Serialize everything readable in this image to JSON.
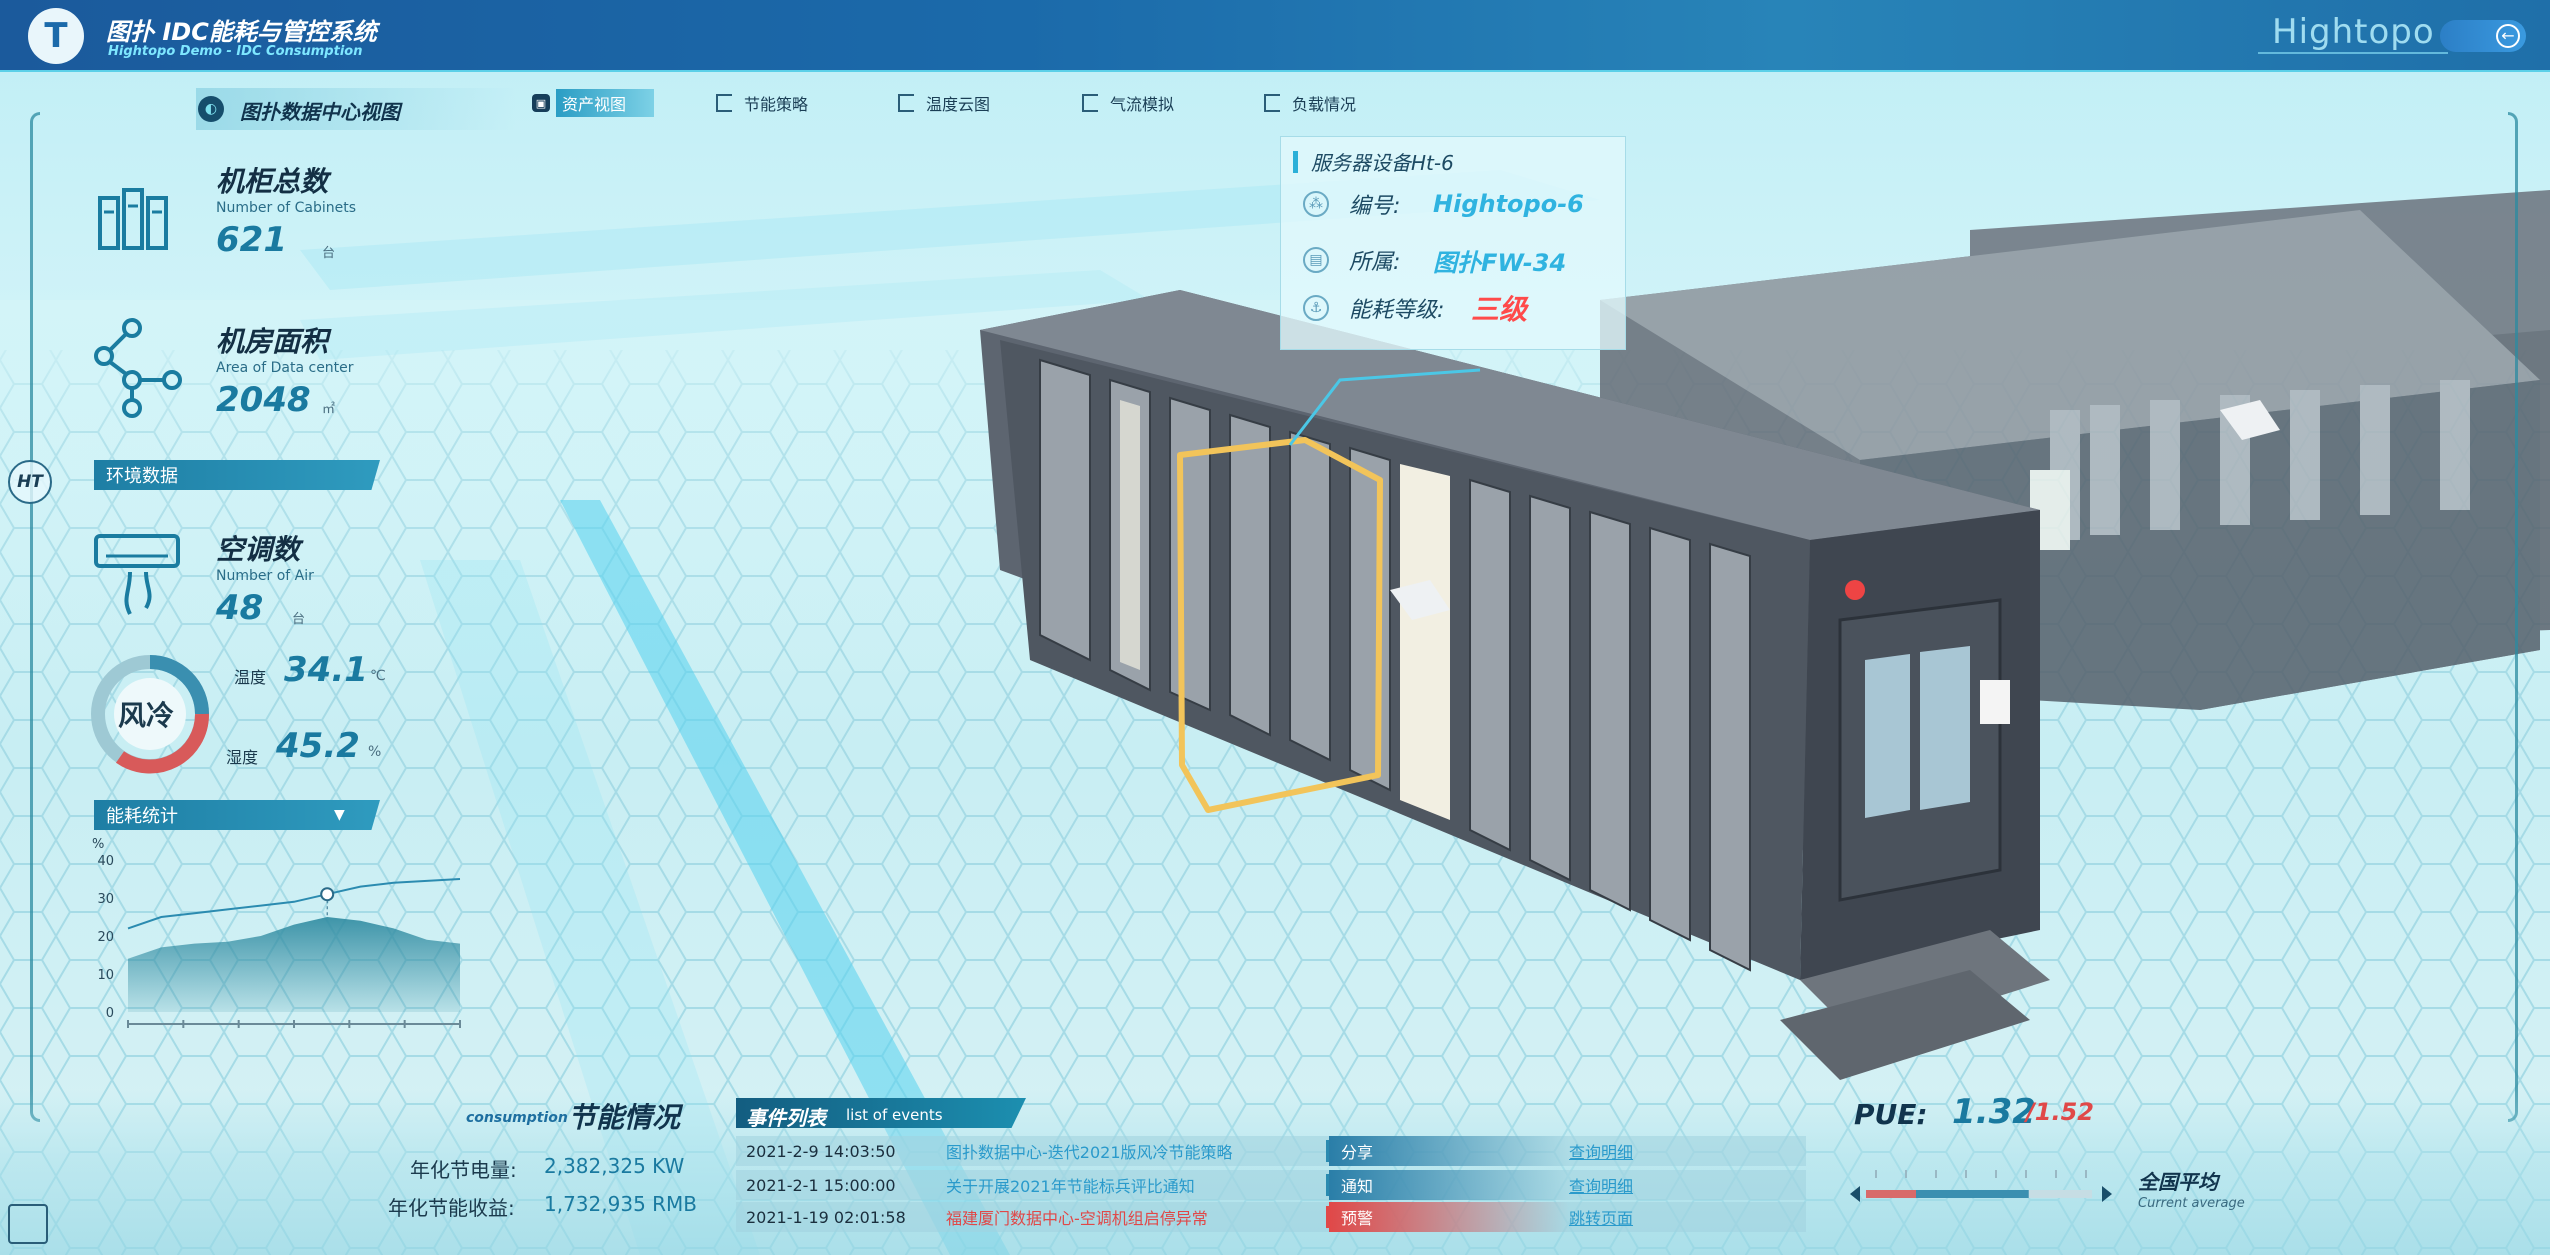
{
  "header": {
    "logo_letter": "T",
    "title": "图扑 IDC能耗与管控系统",
    "subtitle": "Hightopo Demo - IDC Consumption",
    "brand": "Hightopo",
    "back_icon": "arrow-left-icon"
  },
  "view": {
    "title": "图扑数据中心视图",
    "tabs": [
      {
        "label": "资产视图",
        "active": true
      },
      {
        "label": "节能策略",
        "active": false
      },
      {
        "label": "温度云图",
        "active": false
      },
      {
        "label": "气流模拟",
        "active": false
      },
      {
        "label": "负载情况",
        "active": false
      }
    ]
  },
  "stats": {
    "cabinets": {
      "title": "机柜总数",
      "subtitle": "Number of Cabinets",
      "value": "621",
      "unit": "台"
    },
    "area": {
      "title": "机房面积",
      "subtitle": "Area of Data center",
      "value": "2048",
      "unit": "㎡"
    },
    "env_section": "环境数据",
    "air": {
      "title": "空调数",
      "subtitle": "Number of Air",
      "value": "48",
      "unit": "台"
    },
    "cooling": {
      "mode": "风冷",
      "temp_label": "温度",
      "temp_value": "34.1",
      "temp_unit": "℃",
      "hum_label": "湿度",
      "hum_value": "45.2",
      "hum_unit": "%"
    },
    "energy_section": "能耗统计"
  },
  "chart_data": {
    "type": "area",
    "ylabel": "%",
    "ylim": [
      0,
      40
    ],
    "yticks": [
      0,
      10,
      20,
      30,
      40
    ],
    "x": [
      0,
      1,
      2,
      3,
      4,
      5,
      6,
      7,
      8,
      9,
      10
    ],
    "series": [
      {
        "values": [
          14,
          17,
          18,
          18.5,
          20,
          23,
          25,
          24,
          22,
          19,
          18
        ]
      },
      {
        "values": [
          22,
          25,
          26,
          27,
          28,
          29,
          31,
          33,
          34,
          34.5,
          35
        ]
      }
    ],
    "marker_index": 6,
    "colors": {
      "area": "#2e8aa0",
      "line": "#2b8bb0"
    }
  },
  "tooltip": {
    "title": "服务器设备Ht-6",
    "rows": [
      {
        "key": "编号:",
        "value": "Hightopo-6",
        "icon": "network-icon"
      },
      {
        "key": "所属:",
        "value": "图扑FW-34",
        "icon": "map-icon"
      },
      {
        "key": "能耗等级:",
        "value": "三级",
        "icon": "anchor-icon"
      }
    ]
  },
  "savings": {
    "title": "节能情况",
    "subtitle": "consumption",
    "rows": [
      {
        "label": "年化节电量:",
        "value": "2,382,325 KW"
      },
      {
        "label": "年化节能收益:",
        "value": "1,732,935 RMB"
      }
    ]
  },
  "events": {
    "title": "事件列表",
    "subtitle": "list of events",
    "rows": [
      {
        "date": "2021-2-9 14:03:50",
        "title": "图扑数据中心-迭代2021版风冷节能策略",
        "type": "分享",
        "type_color": "#2a7ea8",
        "link": "查询明细",
        "alarm": false
      },
      {
        "date": "2021-2-1 15:00:00",
        "title": "关于开展2021年节能标兵评比通知",
        "type": "通知",
        "type_color": "#2a7ea8",
        "link": "查询明细",
        "alarm": false
      },
      {
        "date": "2021-1-19 02:01:58",
        "title": "福建厦门数据中心-空调机组启停异常",
        "type": "预警",
        "type_color": "#e04848",
        "link": "跳转页面",
        "alarm": true
      }
    ]
  },
  "pue": {
    "label": "PUE:",
    "value": "1.32",
    "average": "/1.52",
    "national_label": "全国平均",
    "national_sub": "Current average",
    "fill_fraction": 0.72
  },
  "badge": "HT"
}
